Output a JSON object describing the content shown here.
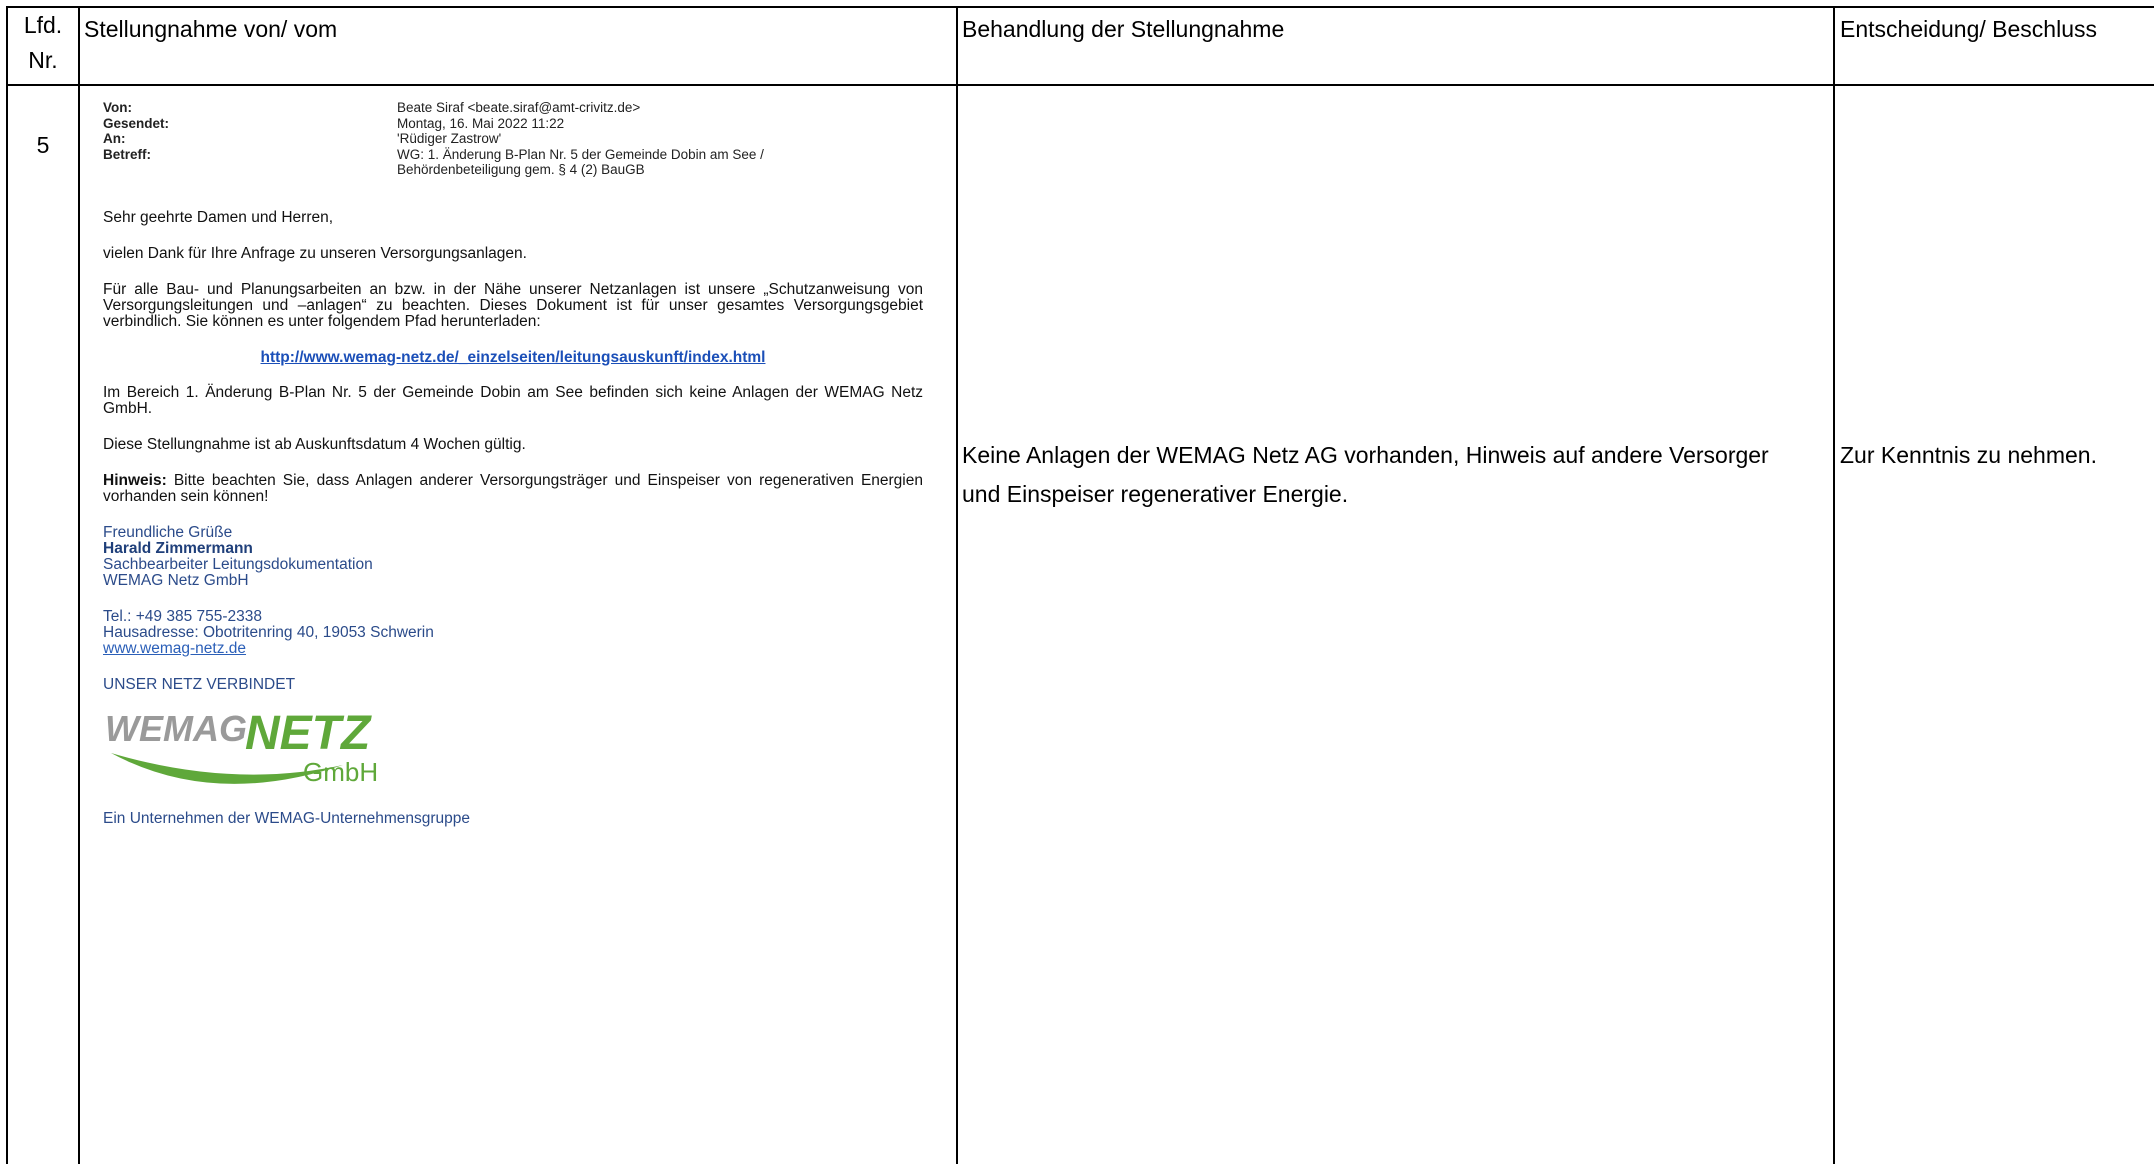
{
  "table": {
    "headers": {
      "nr_line1": "Lfd.",
      "nr_line2": "Nr.",
      "von": "Stellungnahme von/ vom",
      "behandlung": "Behandlung der Stellungnahme",
      "entscheidung": "Entscheidung/ Beschluss"
    },
    "row": {
      "nr": "5",
      "behandlung_line1": "Keine Anlagen der WEMAG Netz AG vorhanden, Hinweis auf andere Versorger",
      "behandlung_line2": "und Einspeiser regenerativer Energie.",
      "entscheidung": "Zur Kenntnis zu nehmen."
    }
  },
  "email": {
    "header": [
      {
        "key": "Von:",
        "value": "Beate Siraf <beate.siraf@amt-crivitz.de>"
      },
      {
        "key": "Gesendet:",
        "value": "Montag, 16. Mai 2022 11:22"
      },
      {
        "key": "An:",
        "value": "'Rüdiger Zastrow'"
      },
      {
        "key": "Betreff:",
        "value": "WG: 1. Änderung B-Plan Nr. 5 der Gemeinde Dobin am See /"
      },
      {
        "key": "",
        "value": "Behördenbeteiligung gem. § 4 (2) BauGB"
      }
    ],
    "greeting": "Sehr geehrte Damen und Herren,",
    "thanks": "vielen Dank für Ihre Anfrage zu unseren Versorgungsanlagen.",
    "para1": "Für alle Bau- und Planungsarbeiten an bzw. in der Nähe unserer Netzanlagen ist unsere „Schutzanweisung von Versorgungsleitungen und –anlagen“ zu beachten. Dieses Dokument ist für unser gesamtes Versorgungsgebiet verbindlich. Sie können es unter folgendem Pfad herunterladen:",
    "link": "http://www.wemag-netz.de/_einzelseiten/leitungsauskunft/index.html",
    "para2": "Im Bereich 1. Änderung B-Plan Nr. 5 der Gemeinde Dobin am See befinden sich keine Anlagen der WEMAG Netz GmbH.",
    "para3": "Diese Stellungnahme ist ab Auskunftsdatum 4 Wochen gültig.",
    "hint_label": "Hinweis:",
    "hint_text": " Bitte beachten Sie, dass Anlagen anderer Versorgungsträger und Einspeiser von regenerativen Energien vorhanden sein können!",
    "closing": "Freundliche Grüße",
    "name": "Harald Zimmermann",
    "role": "Sachbearbeiter Leitungsdokumentation",
    "company": "WEMAG Netz GmbH",
    "phone": "Tel.: +49 385 755-2338",
    "address": "Hausadresse: Obotritenring 40, 19053 Schwerin",
    "web": "www.wemag-netz.de",
    "slogan": "UNSER NETZ VERBINDET",
    "logo": {
      "word1": "WEMAG",
      "word2": "NETZ",
      "word3": "GmbH",
      "gray": "#9a9a9a",
      "green": "#5fa83a"
    },
    "footer": "Ein Unternehmen der WEMAG-Unternehmensgruppe"
  }
}
